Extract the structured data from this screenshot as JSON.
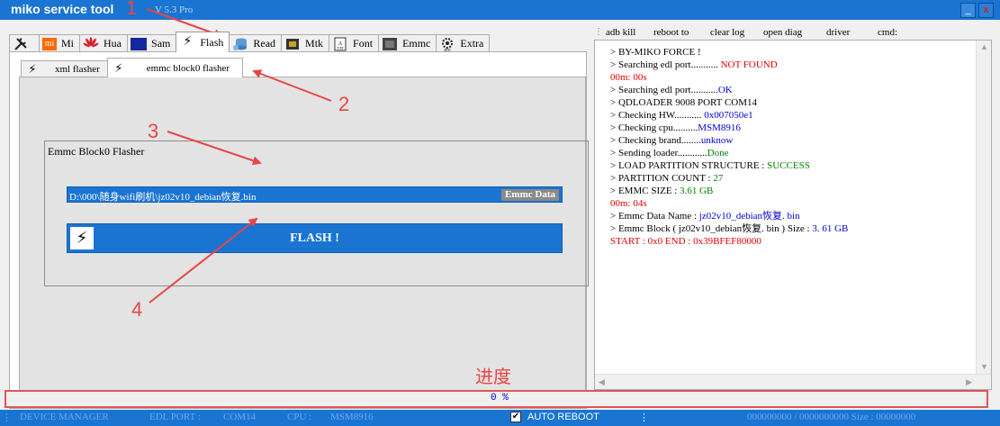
{
  "window": {
    "title": "miko service tool",
    "version": "V 5.3 Pro",
    "minimize_label": "_",
    "close_label": "x"
  },
  "main_tabs": [
    {
      "label": "",
      "icon": "tools-icon"
    },
    {
      "label": "Mi",
      "icon": "xiaomi-logo-icon"
    },
    {
      "label": "Hua",
      "icon": "huawei-logo-icon"
    },
    {
      "label": "Sam",
      "icon": "samsung-logo-icon"
    },
    {
      "label": "Flash",
      "icon": "lightning-icon"
    },
    {
      "label": "Read",
      "icon": "database-icon"
    },
    {
      "label": "Mtk",
      "icon": "chip-icon"
    },
    {
      "label": "Font",
      "icon": "font-file-icon"
    },
    {
      "label": "Emmc",
      "icon": "memory-chip-icon"
    },
    {
      "label": "Extra",
      "icon": "gear-rte-icon"
    }
  ],
  "sub_tabs": [
    {
      "label": "xml flasher",
      "icon": "lightning-icon"
    },
    {
      "label": "emmc block0 flasher",
      "icon": "lightning-icon"
    }
  ],
  "flasher": {
    "group_title": "Emmc Block0 Flasher",
    "file_path": "D:\\000\\随身wifi刷机\\jz02v10_debian恢复.bin",
    "file_tag": "Emmc Data",
    "flash_button": "FLASH !"
  },
  "toolbar": [
    "adb kill",
    "reboot to",
    "clear log",
    "open diag",
    "driver",
    "cmd:"
  ],
  "log": [
    {
      "parts": [
        {
          "text": " > BY-MIKO FORCE !",
          "color": "black"
        }
      ]
    },
    {
      "parts": [
        {
          "text": " > Searching edl port........... ",
          "color": "black"
        },
        {
          "text": "NOT FOUND",
          "color": "red"
        }
      ]
    },
    {
      "parts": [
        {
          "text": "00m: 00s",
          "color": "red"
        }
      ]
    },
    {
      "parts": [
        {
          "text": " > Searching edl port...........",
          "color": "black"
        },
        {
          "text": "OK",
          "color": "blue"
        }
      ]
    },
    {
      "parts": [
        {
          "text": " > QDLOADER 9008 PORT COM14",
          "color": "black"
        }
      ]
    },
    {
      "parts": [
        {
          "text": " > Checking HW........... ",
          "color": "black"
        },
        {
          "text": "0x007050e1",
          "color": "blue"
        }
      ]
    },
    {
      "parts": [
        {
          "text": " > Checking cpu..........",
          "color": "black"
        },
        {
          "text": "MSM8916",
          "color": "blue"
        }
      ]
    },
    {
      "parts": [
        {
          "text": " > Checking brand........",
          "color": "black"
        },
        {
          "text": "unknow",
          "color": "blue"
        }
      ]
    },
    {
      "parts": [
        {
          "text": " > Sending loader............",
          "color": "black"
        },
        {
          "text": "Done",
          "color": "green"
        }
      ]
    },
    {
      "parts": [
        {
          "text": " > LOAD PARTITION  STRUCTURE  :  ",
          "color": "black"
        },
        {
          "text": "SUCCESS",
          "color": "green"
        }
      ]
    },
    {
      "parts": [
        {
          "text": " > PARTITION COUNT  :  ",
          "color": "black"
        },
        {
          "text": "27",
          "color": "green"
        }
      ]
    },
    {
      "parts": [
        {
          "text": " > EMMC SIZE   :  ",
          "color": "black"
        },
        {
          "text": "3.61 GB",
          "color": "green"
        }
      ]
    },
    {
      "parts": [
        {
          "text": "00m: 04s",
          "color": "red"
        }
      ]
    },
    {
      "parts": [
        {
          "text": " > Emmc Data Name  :  ",
          "color": "black"
        },
        {
          "text": "jz02v10_debian恢复. bin",
          "color": "blue"
        }
      ]
    },
    {
      "parts": [
        {
          "text": " > Emmc Block ( jz02v10_debian恢复. bin  )  Size     :     ",
          "color": "black"
        },
        {
          "text": "3. 61  GB",
          "color": "blue"
        }
      ]
    },
    {
      "parts": [
        {
          "text": "  START  :   0x0     END  :   0x39BFEF80000",
          "color": "red"
        }
      ]
    }
  ],
  "progress": {
    "label": "进度",
    "text": "0  %",
    "percent": 0
  },
  "statusbar": {
    "device_manager": "DEVICE MANAGER",
    "edl_port_label": "EDL PORT :",
    "edl_port_value": "COM14",
    "cpu_label": "CPU :",
    "cpu_value": "MSM8916",
    "auto_reboot_label": "AUTO REBOOT",
    "auto_reboot_checked": true,
    "transfer": "000000000 / 0000000000 Size : 00000000"
  },
  "annotations": [
    "1",
    "2",
    "3",
    "4"
  ],
  "colors": {
    "accent": "#1a74d2",
    "annotation": "#e94545",
    "log_red": "#e00000",
    "log_blue": "#0000d0",
    "log_green": "#008000"
  }
}
